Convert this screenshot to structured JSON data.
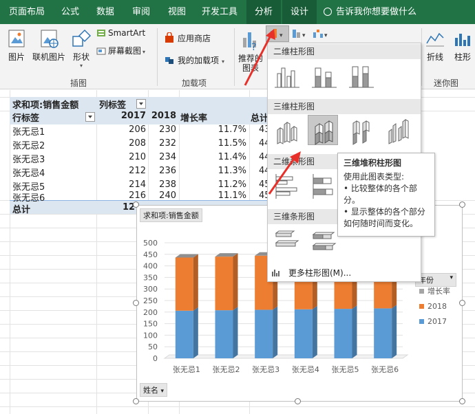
{
  "ribbon_tabs": [
    {
      "label": "页面布局"
    },
    {
      "label": "公式"
    },
    {
      "label": "数据"
    },
    {
      "label": "审阅"
    },
    {
      "label": "视图"
    },
    {
      "label": "开发工具"
    },
    {
      "label": "分析"
    },
    {
      "label": "设计"
    }
  ],
  "tell_me": "告诉我你想要做什么",
  "ribbon": {
    "picture": "图片",
    "online_picture": "联机图片",
    "shapes": "形状",
    "smartart": "SmartArt",
    "screenshot": "屏幕截图",
    "illustrations_group": "插图",
    "store": "应用商店",
    "my_addins": "我的加载项",
    "addins_group": "加载项",
    "recommended_charts": "推荐的图表",
    "line": "折线",
    "column": "柱形",
    "sparklines_group": "迷你图"
  },
  "pivot": {
    "value_header": "求和项:销售金额",
    "col_label": "列标签",
    "row_label": "行标签",
    "years": [
      "2017",
      "2018"
    ],
    "growth_col": "增长率",
    "total_col": "总计",
    "rows": [
      {
        "name": "张无忌1",
        "v2017": "206",
        "v2018": "230",
        "growth": "11.7%",
        "total_partial": "43"
      },
      {
        "name": "张无忌2",
        "v2017": "208",
        "v2018": "232",
        "growth": "11.5%",
        "total_partial": "44"
      },
      {
        "name": "张无忌3",
        "v2017": "210",
        "v2018": "234",
        "growth": "11.4%",
        "total_partial": "44"
      },
      {
        "name": "张无忌4",
        "v2017": "212",
        "v2018": "236",
        "growth": "11.3%",
        "total_partial": "44"
      },
      {
        "name": "张无忌5",
        "v2017": "214",
        "v2018": "238",
        "growth": "11.2%",
        "total_partial": "45"
      },
      {
        "name": "张无忌6",
        "v2017": "216",
        "v2018": "240",
        "growth": "11.1%",
        "total_partial": "45"
      }
    ],
    "grand_total_label": "总计",
    "grand_total_partial": "12"
  },
  "chart_field_buttons": {
    "value_field": "求和项:销售金额",
    "axis_field": "姓名",
    "legend_field": "年份"
  },
  "chart_data": {
    "type": "bar",
    "stacked": true,
    "three_d": true,
    "categories": [
      "张无忌1",
      "张无忌2",
      "张无忌3",
      "张无忌4",
      "张无忌5",
      "张无忌6"
    ],
    "series": [
      {
        "name": "2017",
        "values": [
          206,
          208,
          210,
          212,
          214,
          216
        ],
        "color": "#5b9bd5"
      },
      {
        "name": "2018",
        "values": [
          230,
          232,
          234,
          236,
          238,
          240
        ],
        "color": "#ed7d31"
      },
      {
        "name": "增长率",
        "values": [
          0.117,
          0.115,
          0.114,
          0.113,
          0.112,
          0.111
        ],
        "color": "#a5a5a5"
      }
    ],
    "y_ticks": [
      0,
      50,
      100,
      150,
      200,
      250,
      300,
      350,
      400,
      450,
      500
    ],
    "ylim": [
      0,
      500
    ],
    "legend_position": "right"
  },
  "gallery": {
    "section_2d_column": "二维柱形图",
    "section_3d_column": "三维柱形图",
    "section_2d_bar": "二维条形图",
    "section_3d_bar": "三维条形图",
    "more": "更多柱形图(M)..."
  },
  "tooltip": {
    "title": "三维堆积柱形图",
    "line1": "使用此图表类型:",
    "bullet1": "• 比较整体的各个部分。",
    "bullet2": "• 显示整体的各个部分如何随时间而变化。"
  },
  "colors": {
    "excel_green": "#217346",
    "series_2017": "#5b9bd5",
    "series_2018": "#ed7d31",
    "series_growth": "#a5a5a5",
    "arrow_red": "#e8302a"
  }
}
